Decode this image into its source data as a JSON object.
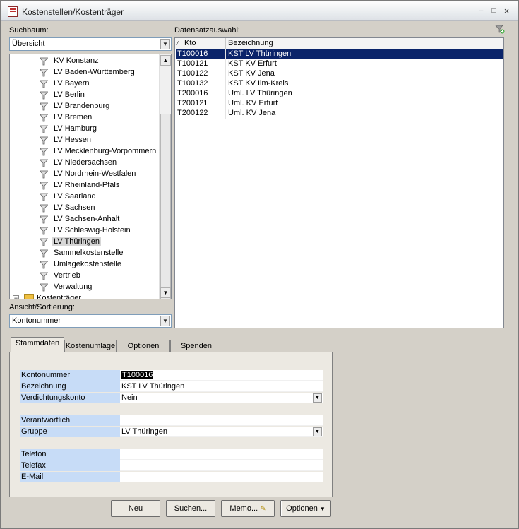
{
  "window": {
    "title": "Kostenstellen/Kostenträger",
    "minimize": "–",
    "restore": "□",
    "close": "×"
  },
  "suchbaum": {
    "label": "Suchbaum:",
    "combo_value": "Übersicht",
    "items": [
      "KV Konstanz",
      "LV Baden-Württemberg",
      "LV Bayern",
      "LV Berlin",
      "LV Brandenburg",
      "LV Bremen",
      "LV Hamburg",
      "LV Hessen",
      "LV Mecklenburg-Vorpommern",
      "LV Niedersachsen",
      "LV Nordrhein-Westfalen",
      "LV Rheinland-Pfals",
      "LV Saarland",
      "LV Sachsen",
      "LV Sachsen-Anhalt",
      "LV Schleswig-Holstein",
      "LV Thüringen",
      "Sammelkostenstelle",
      "Umlagekostenstelle",
      "Vertrieb",
      "Verwaltung"
    ],
    "selected_index": 16,
    "next_node": "Kostenträger",
    "expander": "−"
  },
  "sortierung": {
    "label": "Ansicht/Sortierung:",
    "combo_value": "Kontonummer"
  },
  "datensatz": {
    "label": "Datensatzauswahl:",
    "columns": [
      "Kto",
      "Bezeichnung"
    ],
    "rows": [
      {
        "kto": "T100016",
        "bez": "KST LV Thüringen"
      },
      {
        "kto": "T100121",
        "bez": "KST KV Erfurt"
      },
      {
        "kto": "T100122",
        "bez": "KST KV Jena"
      },
      {
        "kto": "T100132",
        "bez": "KST KV Ilm-Kreis"
      },
      {
        "kto": "T200016",
        "bez": "Uml. LV Thüringen"
      },
      {
        "kto": "T200121",
        "bez": "Uml. KV Erfurt"
      },
      {
        "kto": "T200122",
        "bez": "Uml. KV Jena"
      }
    ],
    "selected_index": 0
  },
  "tabs": [
    "Stammdaten",
    "Kostenumlage",
    "Optionen",
    "Spenden"
  ],
  "active_tab": 0,
  "form": {
    "kontonummer": {
      "label": "Kontonummer",
      "value": "T100016"
    },
    "bezeichnung": {
      "label": "Bezeichnung",
      "value": "KST LV Thüringen"
    },
    "verdichtungskonto": {
      "label": "Verdichtungskonto",
      "value": "Nein"
    },
    "verantwortlich": {
      "label": "Verantwortlich",
      "value": ""
    },
    "gruppe": {
      "label": "Gruppe",
      "value": "LV Thüringen"
    },
    "telefon": {
      "label": "Telefon",
      "value": ""
    },
    "telefax": {
      "label": "Telefax",
      "value": ""
    },
    "email": {
      "label": "E-Mail",
      "value": ""
    }
  },
  "buttons": {
    "neu": "Neu",
    "suchen": "Suchen...",
    "memo": "Memo...",
    "optionen": "Optionen"
  }
}
